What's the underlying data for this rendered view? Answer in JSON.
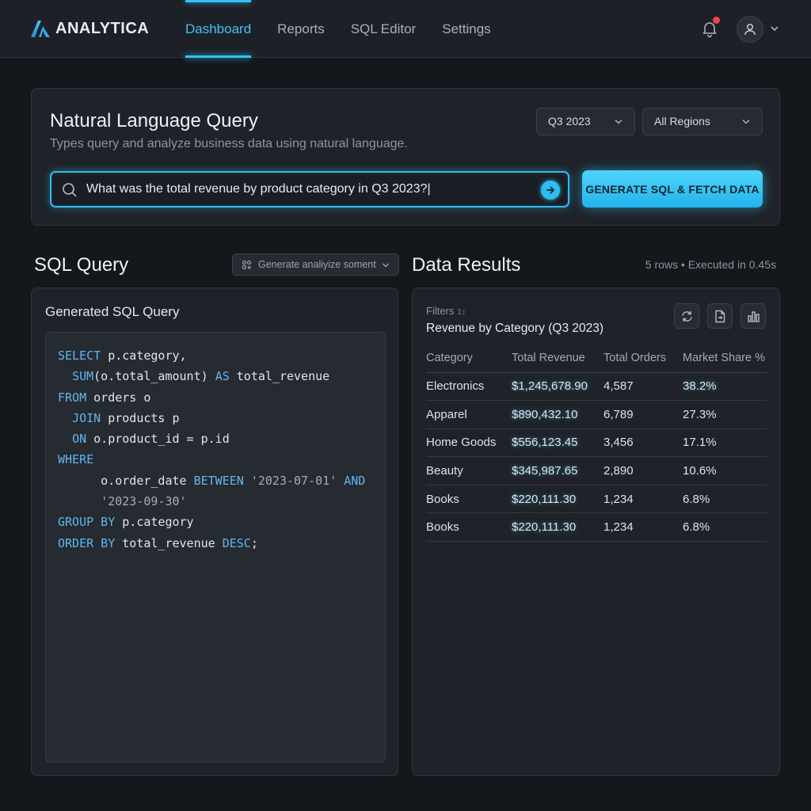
{
  "app": {
    "name": "ANALYTICA"
  },
  "nav": {
    "items": [
      {
        "label": "Dashboard",
        "active": true
      },
      {
        "label": "Reports",
        "active": false
      },
      {
        "label": "SQL Editor",
        "active": false
      },
      {
        "label": "Settings",
        "active": false
      }
    ]
  },
  "header_icons": {
    "notification": "bell-icon",
    "user": "user-icon",
    "has_unread": true
  },
  "nlq": {
    "title": "Natural Language Query",
    "subtitle": "Types query and analyze business data using natural language.",
    "period_select": "Q3 2023",
    "region_select": "All Regions",
    "search_value": "What was the total revenue by product category in Q3 2023?|",
    "generate_label": "GENERATE SQL & FETCH DATA"
  },
  "sql_section": {
    "title": "SQL Query",
    "analyze_dropdown": "Generate analiyize soment",
    "panel_label": "Generated SQL Query"
  },
  "data_section": {
    "title": "Data Results",
    "exec_info": "5 rows • Executed in 0.45s",
    "filters_label": "Filters",
    "filters_count": "1↕",
    "chart_title": "Revenue by Category (Q3 2023)",
    "table": {
      "headers": [
        "Category",
        "Total Revenue",
        "Total Orders",
        "Market Share %"
      ],
      "rows": [
        {
          "category": "Electronics",
          "revenue": "$1,245,678.90",
          "orders": "4,587",
          "share": "38.2%"
        },
        {
          "category": "Apparel",
          "revenue": "$890,432.10",
          "orders": "6,789",
          "share": "27.3%"
        },
        {
          "category": "Home Goods",
          "revenue": "$556,123.45",
          "orders": "3,456",
          "share": "17.1%"
        },
        {
          "category": "Beauty",
          "revenue": "$345,987.65",
          "orders": "2,890",
          "share": "10.6%"
        },
        {
          "category": "Books",
          "revenue": "$220,111.30",
          "orders": "1,234",
          "share": "6.8%"
        },
        {
          "category": "Books",
          "revenue": "$220,111.30",
          "orders": "1,234",
          "share": "6.8%"
        }
      ]
    }
  },
  "colors": {
    "accent": "#2fbef2",
    "background": "#14171c",
    "panel": "#1f2329",
    "keyword": "#5fb7ee"
  }
}
